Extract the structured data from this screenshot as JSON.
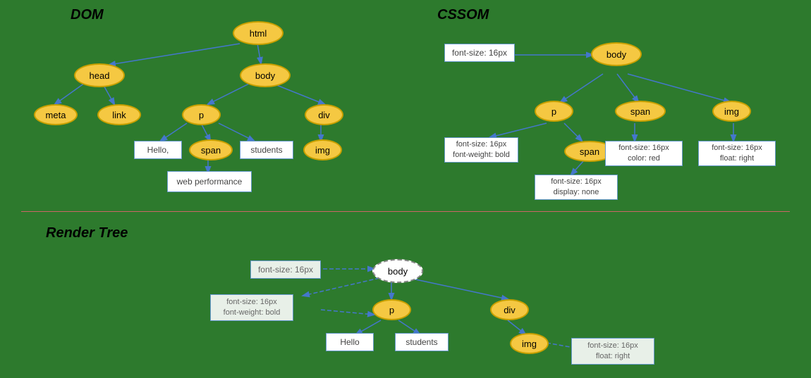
{
  "sections": {
    "dom_label": "DOM",
    "cssom_label": "CSSOM",
    "render_tree_label": "Render Tree"
  },
  "dom_nodes": {
    "html": "html",
    "head": "head",
    "body": "body",
    "meta": "meta",
    "link": "link",
    "p": "p",
    "div": "div",
    "span": "span",
    "img": "img",
    "hello": "Hello,",
    "students": "students",
    "web_performance": "web performance"
  },
  "cssom_nodes": {
    "body": "body",
    "p": "p",
    "span_top": "span",
    "img_top": "img",
    "span_bottom": "span",
    "font_size_body": "font-size: 16px",
    "font_size_p": "font-size: 16px\nfont-weight: bold",
    "font_size_span": "font-size: 16px\ncolor: red",
    "font_size_img": "font-size: 16px\nfloat: right",
    "font_size_span2": "font-size: 16px\ndisplay: none"
  },
  "render_nodes": {
    "body": "body",
    "p": "p",
    "div": "div",
    "img": "img",
    "hello": "Hello",
    "students": "students",
    "font_size_body": "font-size: 16px",
    "font_size_p": "font-size: 16px\nfont-weight: bold",
    "font_size_img": "font-size: 16px\nfloat: right"
  }
}
